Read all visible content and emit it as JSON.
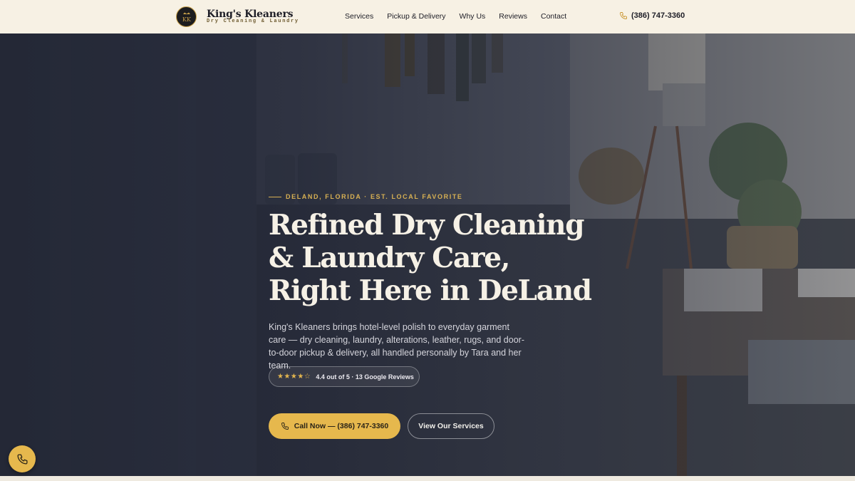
{
  "brand": {
    "name": "King's Kleaners",
    "tagline": "Dry Cleaning & Laundry",
    "logo_monogram": "KK"
  },
  "nav": {
    "items": [
      "Services",
      "Pickup & Delivery",
      "Why Us",
      "Reviews",
      "Contact"
    ]
  },
  "header_phone": {
    "label": "(386) 747-3360",
    "icon": "phone-icon"
  },
  "hero": {
    "eyebrow": "DELAND, FLORIDA · EST. LOCAL FAVORITE",
    "headline": "Refined Dry Cleaning & Laundry Care, Right Here in DeLand",
    "lede": "King's Kleaners brings hotel-level polish to everyday garment care — dry cleaning, laundry, alterations, leather, rugs, and door-to-door pickup & delivery, all handled personally by Tara and her team.",
    "rating": {
      "stars": "★★★★☆",
      "value": 4.4,
      "text": "4.4 out of 5 · 13 Google Reviews"
    },
    "cta_primary": "Call Now — (386) 747-3360",
    "cta_secondary": "View Our Services"
  },
  "floating_call": {
    "icon": "phone-icon"
  },
  "colors": {
    "header_bg": "#f7f1e4",
    "accent_gold": "#e6b84d",
    "eyebrow_gold": "#d7b053",
    "headline": "#f6f1e6",
    "dark_text": "#1d1d26"
  }
}
